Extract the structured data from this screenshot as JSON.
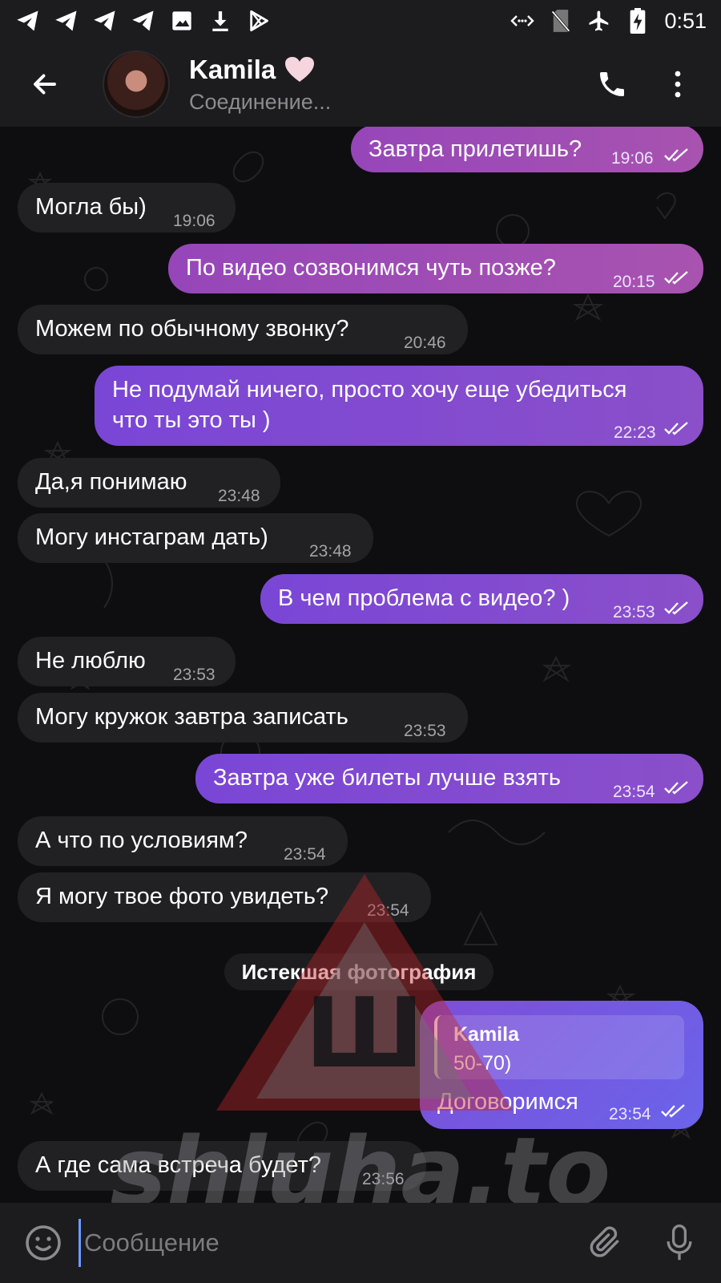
{
  "status_bar": {
    "time": "0:51",
    "left_icons": [
      "telegram-icon",
      "telegram-icon",
      "telegram-icon",
      "telegram-icon",
      "image-icon",
      "download-icon",
      "play-store-icon"
    ],
    "right_icons": [
      "data-arrows-icon",
      "no-sim-icon",
      "airplane-icon",
      "battery-charging-icon"
    ]
  },
  "header": {
    "title": "Kamila",
    "status": "Соединение...",
    "back_icon": "arrow-left-icon",
    "call_icon": "phone-icon",
    "menu_icon": "more-vert-icon"
  },
  "messages": [
    {
      "dir": "out",
      "text": "Завтра прилетишь?",
      "time": "19:06"
    },
    {
      "dir": "in",
      "text": "Могла бы)",
      "time": "19:06"
    },
    {
      "dir": "out",
      "text": "По видео созвонимся чуть позже?",
      "time": "20:15"
    },
    {
      "dir": "in",
      "text": "Можем по обычному звонку?",
      "time": "20:46"
    },
    {
      "dir": "out",
      "text_line1": "Не подумай ничего, просто хочу еще убедиться",
      "text_line2": "что ты это ты )",
      "time": "22:23"
    },
    {
      "dir": "in",
      "text": "Да,я понимаю",
      "time": "23:48"
    },
    {
      "dir": "in",
      "text": "Могу инстаграм дать)",
      "time": "23:48"
    },
    {
      "dir": "out",
      "text": "В чем проблема с видео? )",
      "time": "23:53"
    },
    {
      "dir": "in",
      "text": "Не люблю",
      "time": "23:53"
    },
    {
      "dir": "in",
      "text": "Могу кружок завтра записать",
      "time": "23:53"
    },
    {
      "dir": "out",
      "text": "Завтра уже билеты лучше взять",
      "time": "23:54"
    },
    {
      "dir": "in",
      "text": "А что по условиям?",
      "time": "23:54"
    },
    {
      "dir": "in",
      "text": "Я могу твое фото увидеть?",
      "time": "23:54"
    },
    {
      "dir": "out",
      "reply_name": "Kamila",
      "reply_text": "50-70)",
      "text": "Договоримся",
      "time": "23:54"
    },
    {
      "dir": "in",
      "text": "А где сама встреча будет?",
      "time": "23:56"
    }
  ],
  "service_message": "Истекшая фотография",
  "watermark": {
    "text": "shluha.to",
    "glyph": "Ш"
  },
  "input": {
    "placeholder": "Сообщение",
    "emoji_icon": "emoji-icon",
    "attach_icon": "paperclip-icon",
    "mic_icon": "microphone-icon"
  },
  "colors": {
    "outgoing_bubble": "#7a46d6",
    "outgoing_bubble_pink": "#9646b9",
    "incoming_bubble": "#212124",
    "background": "#0e0e10",
    "bars": "#1c1c1f"
  }
}
